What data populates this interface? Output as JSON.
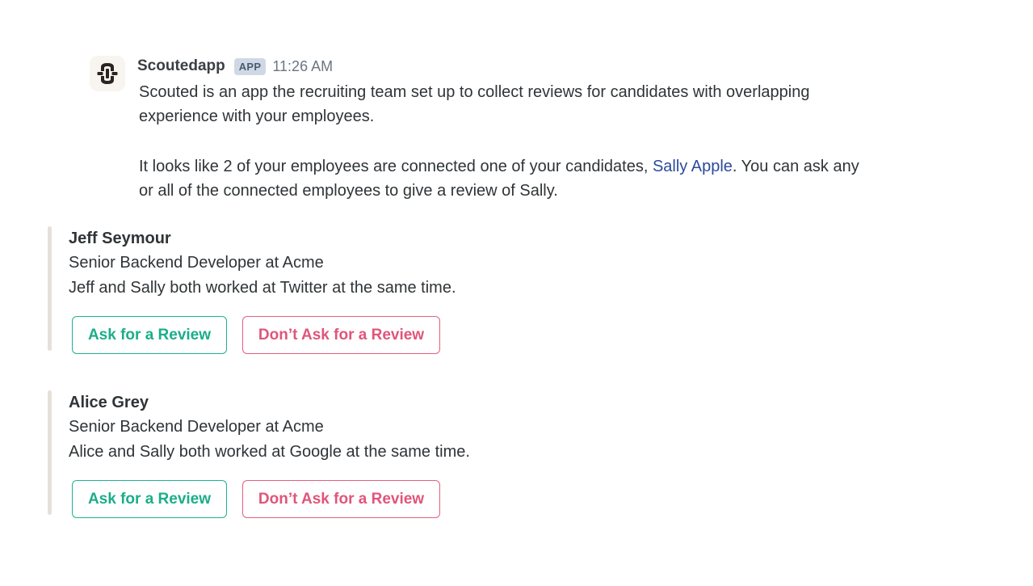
{
  "app": {
    "sender": "Scoutedapp",
    "badge": "APP",
    "time": "11:26 AM",
    "avatar_icon": "scouted-logo-icon",
    "accent_colors": {
      "ask": "#1bad8a",
      "dont": "#e0557a",
      "link": "#2a4a9b"
    }
  },
  "message": {
    "intro": "Scouted is an app the recruiting team set up to collect reviews for candidates with overlapping experience with your employees.",
    "connected_prefix": "It looks like 2 of your employees are connected one of your candidates, ",
    "candidate_link": "Sally Apple",
    "connected_suffix": ". You can ask any or all of the connected employees to give a review of Sally."
  },
  "employees": [
    {
      "name": "Jeff Seymour",
      "title": "Senior Backend Developer at Acme",
      "overlap": "Jeff and Sally both worked at Twitter at the same time.",
      "ask_label": "Ask for a Review",
      "dont_label": "Don’t Ask for a Review"
    },
    {
      "name": "Alice Grey",
      "title": "Senior Backend Developer at Acme",
      "overlap": "Alice and Sally both worked at Google at the same time.",
      "ask_label": "Ask for a Review",
      "dont_label": "Don’t Ask for a Review"
    }
  ]
}
